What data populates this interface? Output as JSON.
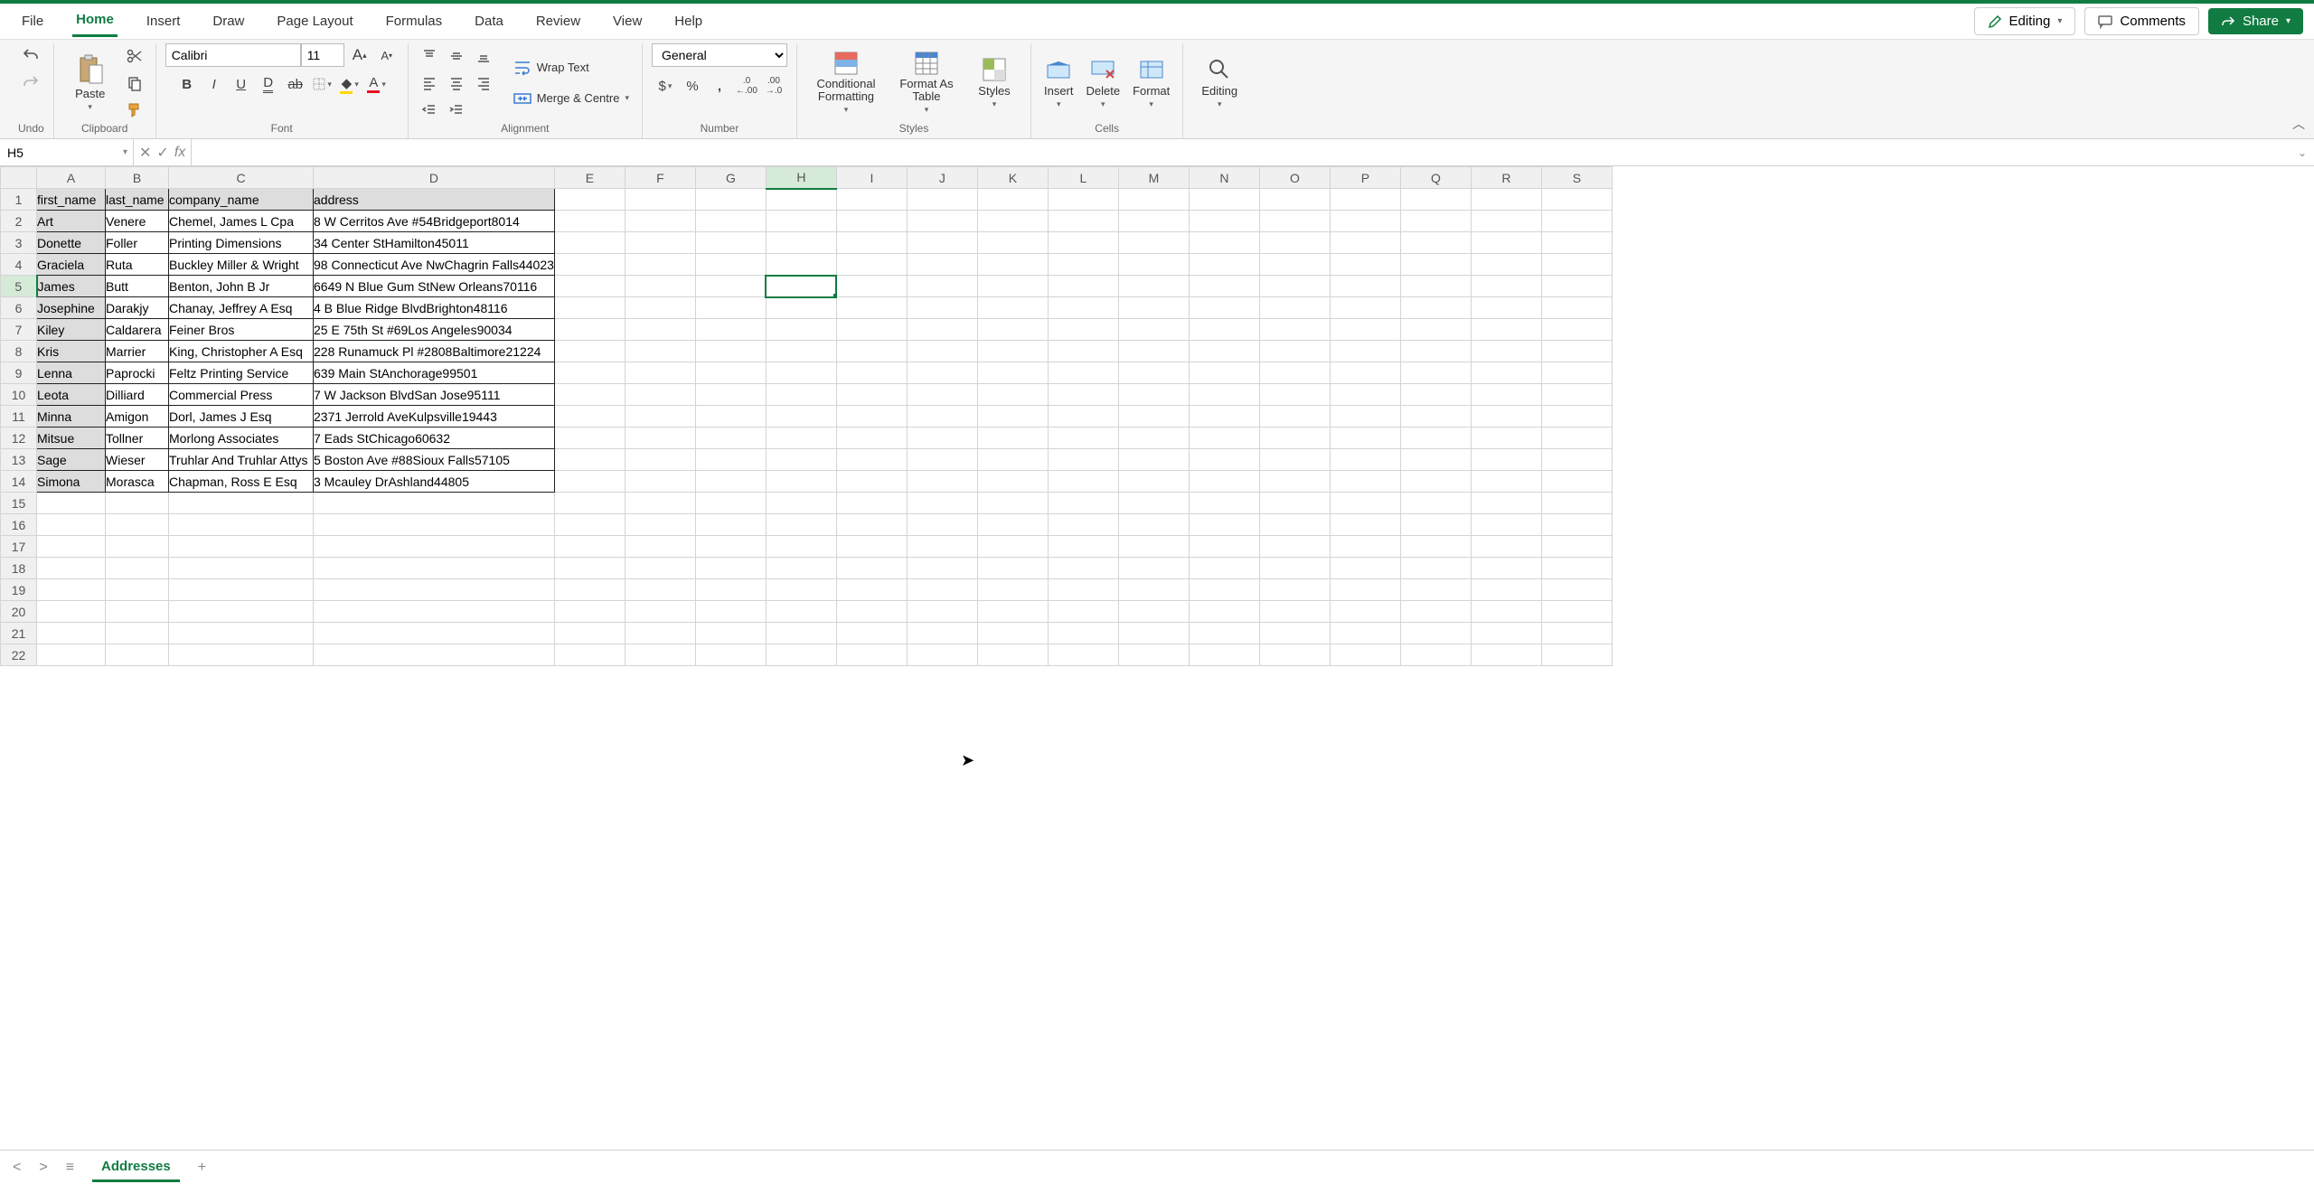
{
  "menu": {
    "items": [
      "File",
      "Home",
      "Insert",
      "Draw",
      "Page Layout",
      "Formulas",
      "Data",
      "Review",
      "View",
      "Help"
    ],
    "active": "Home",
    "editing_label": "Editing",
    "comments_label": "Comments",
    "share_label": "Share"
  },
  "ribbon": {
    "undo_label": "Undo",
    "clipboard": {
      "paste": "Paste",
      "label": "Clipboard"
    },
    "font": {
      "name": "Calibri",
      "size": "11",
      "label": "Font"
    },
    "alignment": {
      "wrap": "Wrap Text",
      "merge": "Merge & Centre",
      "label": "Alignment"
    },
    "number": {
      "format": "General",
      "label": "Number"
    },
    "styles": {
      "cf": "Conditional Formatting",
      "fat": "Format As Table",
      "styles": "Styles",
      "label": "Styles"
    },
    "cells": {
      "insert": "Insert",
      "delete": "Delete",
      "format": "Format",
      "label": "Cells"
    },
    "editing": {
      "editing": "Editing"
    }
  },
  "formula_bar": {
    "name_box": "H5",
    "fx": "fx",
    "value": ""
  },
  "columns": [
    "A",
    "B",
    "C",
    "D",
    "E",
    "F",
    "G",
    "H",
    "I",
    "J",
    "K",
    "L",
    "M",
    "N",
    "O",
    "P",
    "Q",
    "R",
    "S"
  ],
  "active_col": "H",
  "active_row": 5,
  "row_count": 22,
  "sheet": {
    "headers": [
      "first_name",
      "last_name",
      "company_name",
      "address"
    ],
    "rows": [
      {
        "first_name": "Art",
        "last_name": "Venere",
        "company_name": "Chemel, James L Cpa",
        "address": "8 W Cerritos Ave #54Bridgeport8014"
      },
      {
        "first_name": "Donette",
        "last_name": "Foller",
        "company_name": "Printing Dimensions",
        "address": "34 Center StHamilton45011"
      },
      {
        "first_name": "Graciela",
        "last_name": "Ruta",
        "company_name": "Buckley Miller & Wright",
        "address": "98 Connecticut Ave NwChagrin Falls44023"
      },
      {
        "first_name": "James",
        "last_name": "Butt",
        "company_name": "Benton, John B Jr",
        "address": "6649 N Blue Gum StNew Orleans70116"
      },
      {
        "first_name": "Josephine",
        "last_name": "Darakjy",
        "company_name": "Chanay, Jeffrey A Esq",
        "address": "4 B Blue Ridge BlvdBrighton48116"
      },
      {
        "first_name": "Kiley",
        "last_name": "Caldarera",
        "company_name": "Feiner Bros",
        "address": "25 E 75th St #69Los Angeles90034"
      },
      {
        "first_name": "Kris",
        "last_name": "Marrier",
        "company_name": "King, Christopher A Esq",
        "address": "228 Runamuck Pl #2808Baltimore21224"
      },
      {
        "first_name": "Lenna",
        "last_name": "Paprocki",
        "company_name": "Feltz Printing Service",
        "address": "639 Main StAnchorage99501"
      },
      {
        "first_name": "Leota",
        "last_name": "Dilliard",
        "company_name": "Commercial Press",
        "address": "7 W Jackson BlvdSan Jose95111"
      },
      {
        "first_name": "Minna",
        "last_name": "Amigon",
        "company_name": "Dorl, James J Esq",
        "address": "2371 Jerrold AveKulpsville19443"
      },
      {
        "first_name": "Mitsue",
        "last_name": "Tollner",
        "company_name": "Morlong Associates",
        "address": "7 Eads StChicago60632"
      },
      {
        "first_name": "Sage",
        "last_name": "Wieser",
        "company_name": "Truhlar And Truhlar Attys",
        "address": "5 Boston Ave #88Sioux Falls57105"
      },
      {
        "first_name": "Simona",
        "last_name": "Morasca",
        "company_name": "Chapman, Ross E Esq",
        "address": "3 Mcauley DrAshland44805"
      }
    ]
  },
  "status_bar": {
    "sheet_name": "Addresses"
  }
}
